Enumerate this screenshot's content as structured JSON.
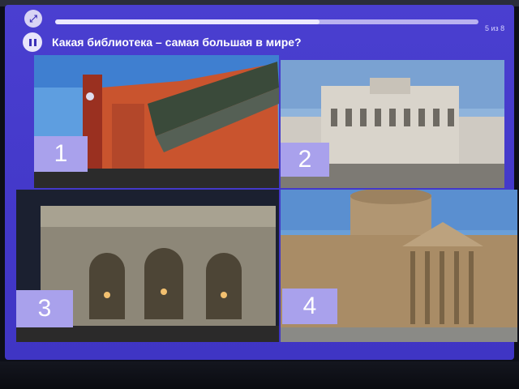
{
  "header": {
    "progress_label": "5 из 8",
    "progress_fraction": 0.625,
    "exit_icon": "collapse-arrows-icon",
    "pause_icon": "pause-icon"
  },
  "question": {
    "text": "Какая библиотека – самая большая в мире?"
  },
  "options": [
    {
      "number": "1",
      "image": "British Library, red brick building with clock tower"
    },
    {
      "number": "2",
      "image": "Library of Congress, classical domed facade"
    },
    {
      "number": "3",
      "image": "New York Public Library, arched stone facade at dusk"
    },
    {
      "number": "4",
      "image": "Paris building with dome and columned portico"
    }
  ],
  "colors": {
    "background": "#4338c9",
    "badge": "#a9a1ec",
    "progress_fill": "#ece9ff"
  }
}
